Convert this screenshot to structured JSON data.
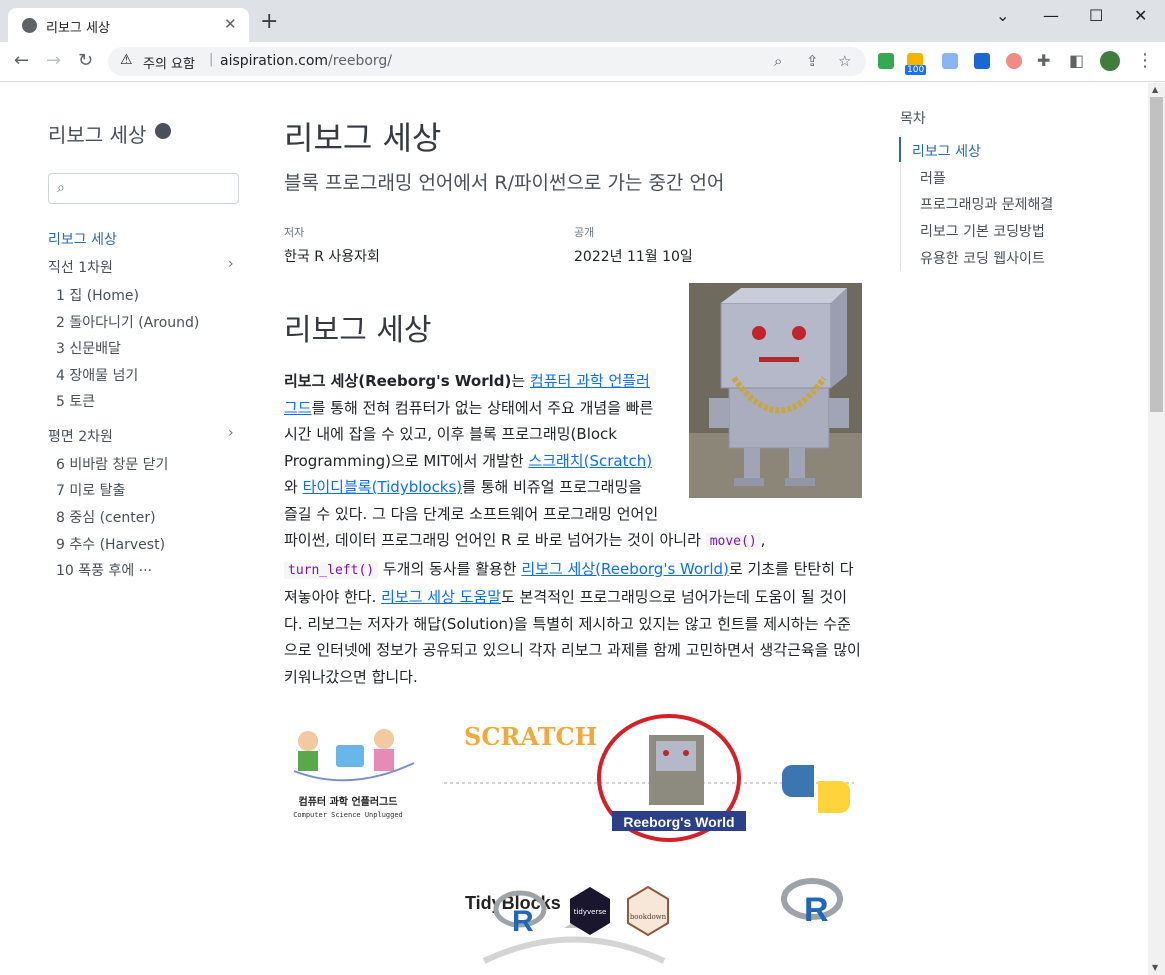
{
  "browser": {
    "tab_title": "리보그 세상",
    "new_tab": "+",
    "security_label": "주의 요함",
    "url_host": "aispiration.com",
    "url_path": "/reeborg/",
    "ext_badge": "100"
  },
  "sidebar": {
    "site_title": "리보그 세상",
    "items": [
      {
        "label": "리보그 세상"
      },
      {
        "label": "직선 1차원"
      },
      {
        "label": "1  집 (Home)"
      },
      {
        "label": "2  돌아다니기 (Around)"
      },
      {
        "label": "3  신문배달"
      },
      {
        "label": "4  장애물 넘기"
      },
      {
        "label": "5  토큰"
      },
      {
        "label": "평면 2차원"
      },
      {
        "label": "6  비바람 창문 닫기"
      },
      {
        "label": "7  미로 탈출"
      },
      {
        "label": "8  중심 (center)"
      },
      {
        "label": "9  추수 (Harvest)"
      },
      {
        "label": "10  폭풍 후에 ···"
      }
    ]
  },
  "main": {
    "title": "리보그 세상",
    "subtitle": "블록 프로그래밍 언어에서 R/파이썬으로 가는 중간 언어",
    "author_label": "저자",
    "author": "한국 R 사용자회",
    "published_label": "공개",
    "published": "2022년 11월 10일",
    "section_heading": "리보그 세상",
    "p_strong": "리보그 세상(Reeborg's World)",
    "p1": "는 ",
    "link1": "컴퓨터 과학 언플러그드",
    "p2": "를 통해 전혀 컴퓨터가 없는 상태에서 주요 개념을 빠른 시간 내에 잡을 수 있고, 이후 블록 프로그래밍(Block Programming)으로 MIT에서 개발한 ",
    "link2": "스크래치(Scratch)",
    "p3": "와 ",
    "link3": "타이디블록(Tidyblocks)",
    "p4": "를 통해 비쥬얼 프로그래밍을 즐길 수 있다. 그 다음 단계로 소프트웨어 프로그래밍 언어인 파이썬, 데이터 프로그래밍 언어인 R 로 바로 넘어가는 것이 아니라 ",
    "code1": "move()",
    "p5": ", ",
    "code2": "turn_left()",
    "p6": " 두개의 동사를 활용한 ",
    "link4": "리보그 세상(Reeborg's World)",
    "p7": "로 기초를 탄탄히 다져놓아야 한다. ",
    "link5": "리보그 세상 도움말",
    "p8": "도 본격적인 프로그래밍으로 넘어가는데 도움이 될 것이다. 리보그는 저자가 해답(Solution)을 특별히 제시하고 있지는 않고 힌트를 제시하는 수준으로 인터넷에 정보가 공유되고 있으니 각자 리보그 과제를 함께 고민하면서 생각근육을 많이 키워나갔으면 합니다."
  },
  "figure": {
    "cs_caption": "컴퓨터 과학 언플러그드",
    "cs_caption_en": "Computer Science Unplugged",
    "scratch": "SCRATCH",
    "tidyblocks": "TidyBlocks",
    "reeborg_label": "Reeborg's World",
    "r_letter": "R",
    "tidyverse": "tidyverse",
    "bookdown": "bookdown"
  },
  "toc": {
    "title": "목차",
    "items": [
      {
        "label": "리보그 세상"
      },
      {
        "label": "러플"
      },
      {
        "label": "프로그래밍과 문제해결"
      },
      {
        "label": "리보그 기본 코딩방법"
      },
      {
        "label": "유용한 코딩 웹사이트"
      }
    ]
  },
  "colors": {
    "accent": "#2c6aa8",
    "link": "#0d6efd",
    "code": "#7d12ba"
  }
}
